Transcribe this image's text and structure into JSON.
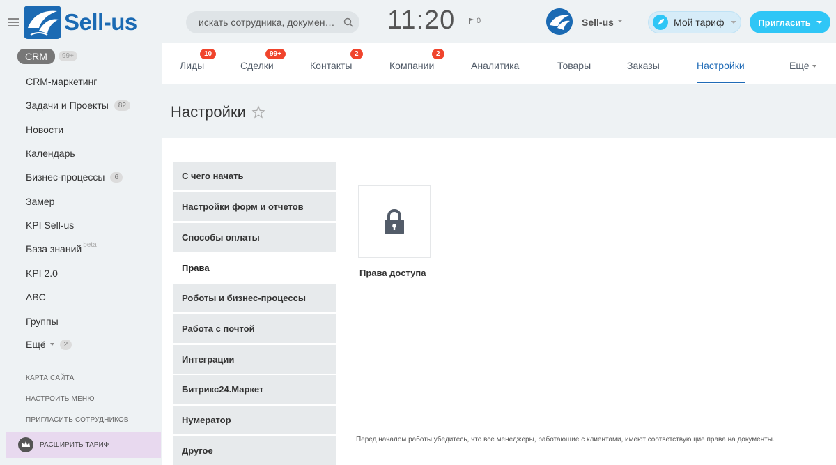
{
  "header": {
    "logo_text": "Sell-us",
    "search_placeholder": "искать сотрудника, докумен…",
    "clock": "11:20",
    "flag_count": "0",
    "company_name": "Sell-us",
    "tariff_label": "Мой тариф",
    "invite_label": "Пригласить"
  },
  "sidebar": {
    "crm_label": "CRM",
    "crm_count": "99+",
    "items": [
      {
        "label": "CRM-маркетинг",
        "badge": ""
      },
      {
        "label": "Задачи и Проекты",
        "badge": "82"
      },
      {
        "label": "Новости",
        "badge": ""
      },
      {
        "label": "Календарь",
        "badge": ""
      },
      {
        "label": "Бизнес-процессы",
        "badge": "6"
      },
      {
        "label": "Замер",
        "badge": ""
      },
      {
        "label": "KPI Sell-us",
        "badge": ""
      },
      {
        "label": "База знаний",
        "badge": ""
      },
      {
        "label": "KPI 2.0",
        "badge": ""
      },
      {
        "label": "ABC",
        "badge": ""
      },
      {
        "label": "Группы",
        "badge": ""
      },
      {
        "label": "Ещё",
        "badge": "2"
      }
    ],
    "beta_tag": "beta",
    "links": [
      "КАРТА САЙТА",
      "НАСТРОИТЬ МЕНЮ",
      "ПРИГЛАСИТЬ СОТРУДНИКОВ"
    ],
    "expand_label": "РАСШИРИТЬ ТАРИФ"
  },
  "tabs": [
    {
      "label": "Лиды",
      "badge": "10"
    },
    {
      "label": "Сделки",
      "badge": "99+"
    },
    {
      "label": "Контакты",
      "badge": "2"
    },
    {
      "label": "Компании",
      "badge": "2"
    },
    {
      "label": "Аналитика",
      "badge": ""
    },
    {
      "label": "Товары",
      "badge": ""
    },
    {
      "label": "Заказы",
      "badge": ""
    },
    {
      "label": "Настройки",
      "badge": ""
    },
    {
      "label": "Еще",
      "badge": ""
    }
  ],
  "page": {
    "title": "Настройки"
  },
  "settings_menu": [
    "С чего начать",
    "Настройки форм и отчетов",
    "Способы оплаты",
    "Права",
    "Роботы и бизнес-процессы",
    "Работа с почтой",
    "Интеграции",
    "Битрикс24.Маркет",
    "Нумератор",
    "Другое"
  ],
  "content": {
    "tile_label": "Права доступа",
    "footnote": "Перед началом работы убедитесь, что все менеджеры, работающие с клиентами, имеют соответствующие права на документы."
  },
  "colors": {
    "accent": "#2fc6f6",
    "brand": "#1b6ab3",
    "active_tab": "#1f6bb7",
    "badge": "#f0442c"
  }
}
